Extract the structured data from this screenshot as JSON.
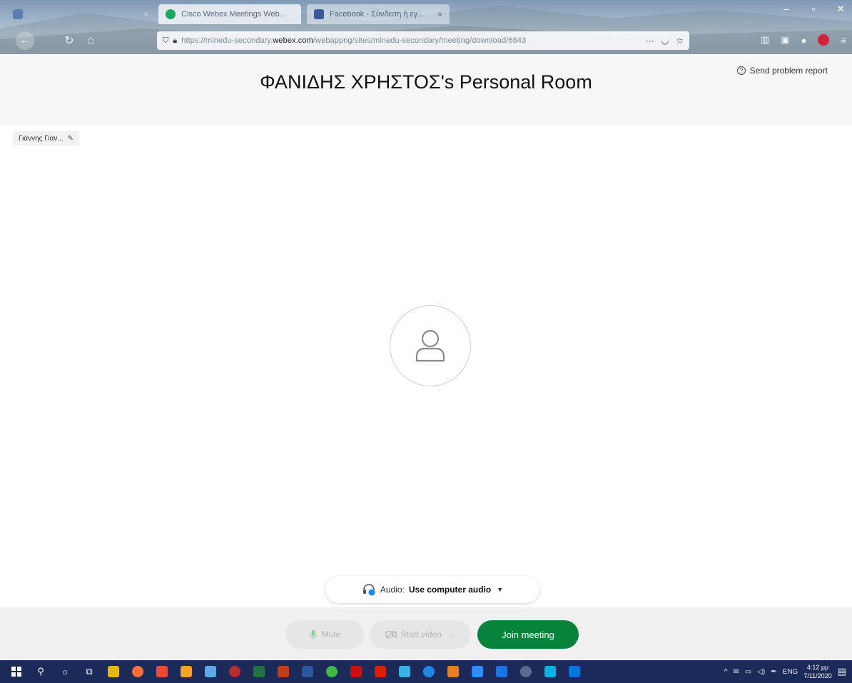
{
  "browser": {
    "tabs": [
      {
        "label": "Cisco Webex Meetings Web...",
        "favicon_color": "#1aa75f"
      },
      {
        "label": "Facebook - Σύνδεση ή εγ...",
        "favicon_color": "#3b5998"
      }
    ],
    "url_prefix": "https://minedu-secondary.",
    "url_domain": "webex.com",
    "url_suffix": "/webappng/sites/minedu-secondary/meeting/download/6843"
  },
  "header": {
    "room_title": "ΦΑΝΙΔΗΣ ΧΡΗΣΤΟΣ's Personal Room",
    "report_label": "Send problem report"
  },
  "self_view": {
    "name": "Γιάννης Γιαν..."
  },
  "audio": {
    "label": "Audio:",
    "value": "Use computer audio"
  },
  "controls": {
    "mute_label": "Mute",
    "video_label": "Start video",
    "join_label": "Join meeting"
  },
  "taskbar": {
    "lang": "ENG",
    "time": "4:12 μμ",
    "date": "7/11/2020",
    "app_colors": [
      "#e8b600",
      "#ff7139",
      "#e94b35",
      "#f2a527",
      "#5da9e9",
      "#b72d2d",
      "#217346",
      "#c43e1c",
      "#2b579a",
      "#41b845",
      "#cc0f16",
      "#d81e05",
      "#3bb0e3",
      "#1e88e5",
      "#e0821f",
      "#2d8cff",
      "#1a73e8",
      "#5a6b8c",
      "#00b4e6",
      "#0078d7"
    ],
    "accent": "#07833b"
  }
}
